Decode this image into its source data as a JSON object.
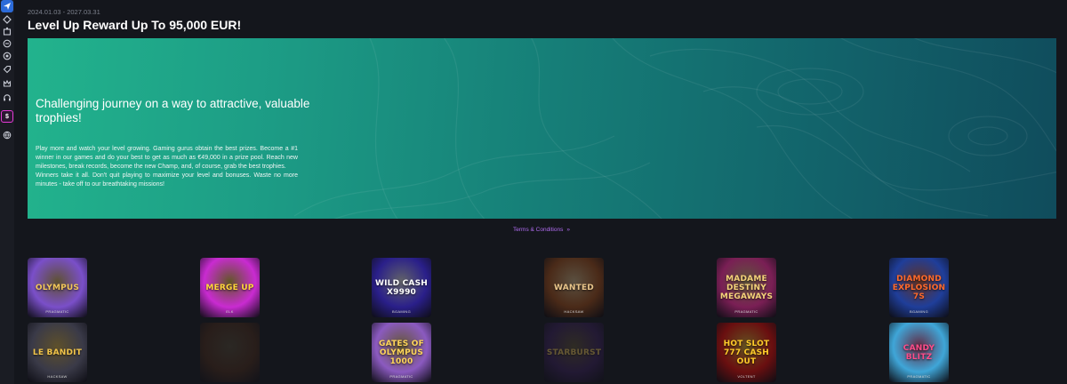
{
  "sidebar": {
    "icons": [
      "rocket-icon",
      "diamond-icon",
      "slot-machine-icon",
      "bonus-icon",
      "chip-icon",
      "tag-icon",
      "crown-icon",
      "headset-icon",
      "promo-icon",
      "globe-icon"
    ],
    "promo_label": "$"
  },
  "promotion": {
    "dates": "2024.01.03 - 2027.03.31",
    "title": "Level Up Reward Up To 95,000 EUR!",
    "banner_heading": "Challenging journey on a way to attractive, valuable trophies!",
    "banner_body": [
      "Play more and watch your level growing. Gaming gurus obtain the best prizes. Become a #1 winner in our games and do your best to get as much as €49,000 in a prize pool. Reach new milestones, break records, become the new Champ, and, of course, grab the best trophies.",
      "Winners take it all. Don't quit playing to maximize your level and bonuses. Waste no more minutes - take off to our breathtaking missions!"
    ],
    "terms_link": "Terms & Conditions",
    "terms_chevron": "»"
  },
  "games": [
    {
      "name": "OLYMPUS",
      "provider": "PRAGMATIC",
      "bg": "#7a4fc9",
      "accent": "#f3c85a"
    },
    {
      "name": "MERGE UP",
      "provider": "ELK",
      "bg": "#c92bd1",
      "accent": "#ffd83a"
    },
    {
      "name": "WILD CASH X9990",
      "provider": "BGAMING",
      "bg": "#2a1f8a",
      "accent": "#ffffff"
    },
    {
      "name": "WANTED",
      "provider": "HACKSAW",
      "bg": "#4a2a18",
      "accent": "#e8c58a"
    },
    {
      "name": "MADAME DESTINY MEGAWAYS",
      "provider": "PRAGMATIC",
      "bg": "#7a1f55",
      "accent": "#f5d37a"
    },
    {
      "name": "DIAMOND EXPLOSION 7S",
      "provider": "BGAMING",
      "bg": "#1f3e9a",
      "accent": "#ff6a2b"
    },
    {
      "name": "LE BANDIT",
      "provider": "HACKSAW",
      "bg": "#3a3a48",
      "accent": "#f1c44a"
    },
    {
      "name": "",
      "provider": "",
      "bg": "#4a2a18",
      "accent": "#c9a25a"
    },
    {
      "name": "GATES OF OLYMPUS 1000",
      "provider": "PRAGMATIC",
      "bg": "#8b5ac0",
      "accent": "#ffd65a"
    },
    {
      "name": "STARBURST",
      "provider": "",
      "bg": "#3a1f5a",
      "accent": "#e8c05a"
    },
    {
      "name": "HOT SLOT 777 CASH OUT",
      "provider": "VOLTENT",
      "bg": "#6a0f10",
      "accent": "#ffcc2a"
    },
    {
      "name": "CANDY BLITZ",
      "provider": "PRAGMATIC",
      "bg": "#3fa6d8",
      "accent": "#ff4d8a"
    }
  ]
}
